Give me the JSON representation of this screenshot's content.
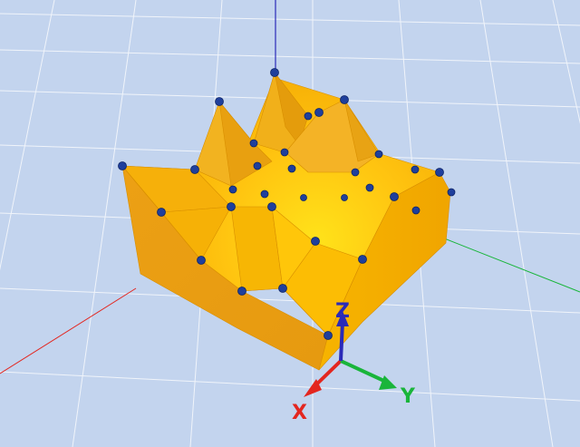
{
  "viewer": {
    "background_color": "#c3d4ee",
    "grid_color": "#ffffff",
    "mesh_color": "#f5a800",
    "vertex_color": "#1f3f9c"
  },
  "axes": {
    "x": {
      "label": "X",
      "color": "#e3261f"
    },
    "y": {
      "label": "Y",
      "color": "#19b53a"
    },
    "z": {
      "label": "Z",
      "color": "#2a2ab8"
    }
  }
}
